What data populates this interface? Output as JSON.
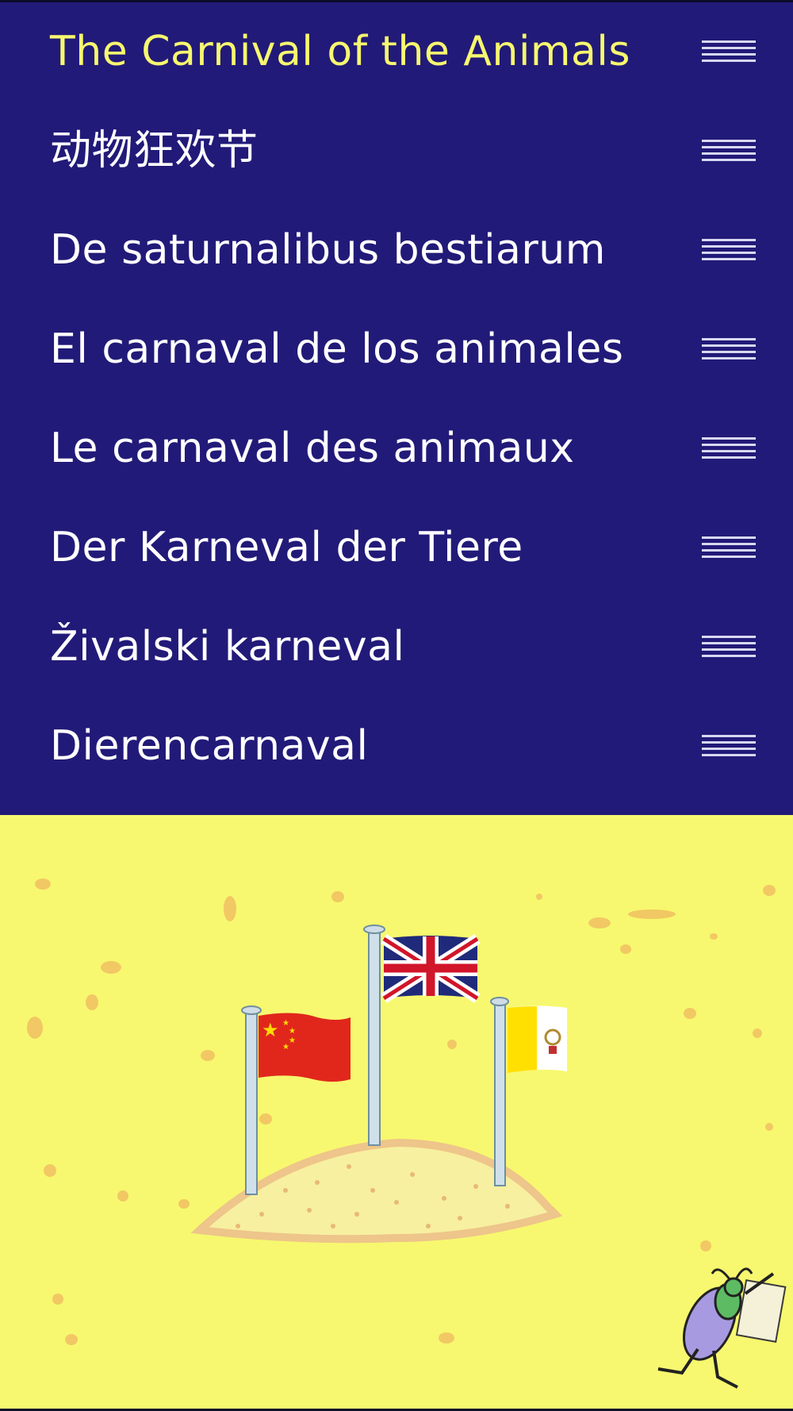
{
  "languages": [
    {
      "label": "The Carnival of the Animals",
      "selected": true
    },
    {
      "label": "动物狂欢节",
      "selected": false
    },
    {
      "label": "De saturnalibus bestiarum",
      "selected": false
    },
    {
      "label": "El carnaval de los animales",
      "selected": false
    },
    {
      "label": "Le carnaval des animaux",
      "selected": false
    },
    {
      "label": "Der Karneval der Tiere",
      "selected": false
    },
    {
      "label": "Živalski karneval",
      "selected": false
    },
    {
      "label": "Dierencarnaval",
      "selected": false
    }
  ],
  "colors": {
    "list_background": "#221a78",
    "selected_text": "#f7f86f",
    "text": "#ffffff",
    "illustration_background": "#f7f86f"
  },
  "icons": {
    "row_handle": "drag-handle-icon",
    "flags": [
      "china-flag-icon",
      "uk-flag-icon",
      "vatican-flag-icon"
    ],
    "mascot": "cricket-mascot-icon"
  }
}
